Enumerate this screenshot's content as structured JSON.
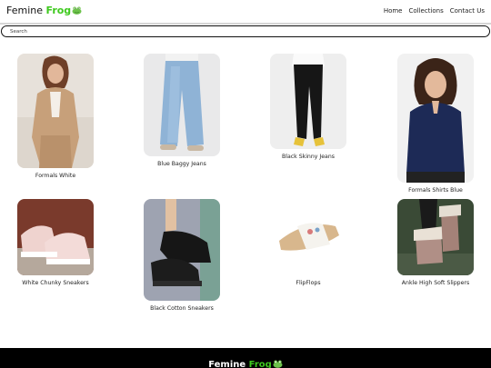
{
  "header": {
    "brand_main": "Femine ",
    "brand_accent": "Frog",
    "nav": [
      "Home",
      "Collections",
      "Contact Us"
    ]
  },
  "search": {
    "placeholder": "Search"
  },
  "products": [
    {
      "name": "Formals White"
    },
    {
      "name": "Blue Baggy Jeans"
    },
    {
      "name": "Black Skinny Jeans"
    },
    {
      "name": "Formals Shirts Blue"
    },
    {
      "name": "White Chunky Sneakers"
    },
    {
      "name": "Black Cotton Sneakers"
    },
    {
      "name": "FlipFlops"
    },
    {
      "name": "Ankle High Soft Slippers"
    }
  ],
  "footer": {
    "brand_main": "Femine ",
    "brand_accent": "Frog"
  },
  "colors": {
    "accent": "#3ec91e",
    "footer_bg": "#000000"
  }
}
